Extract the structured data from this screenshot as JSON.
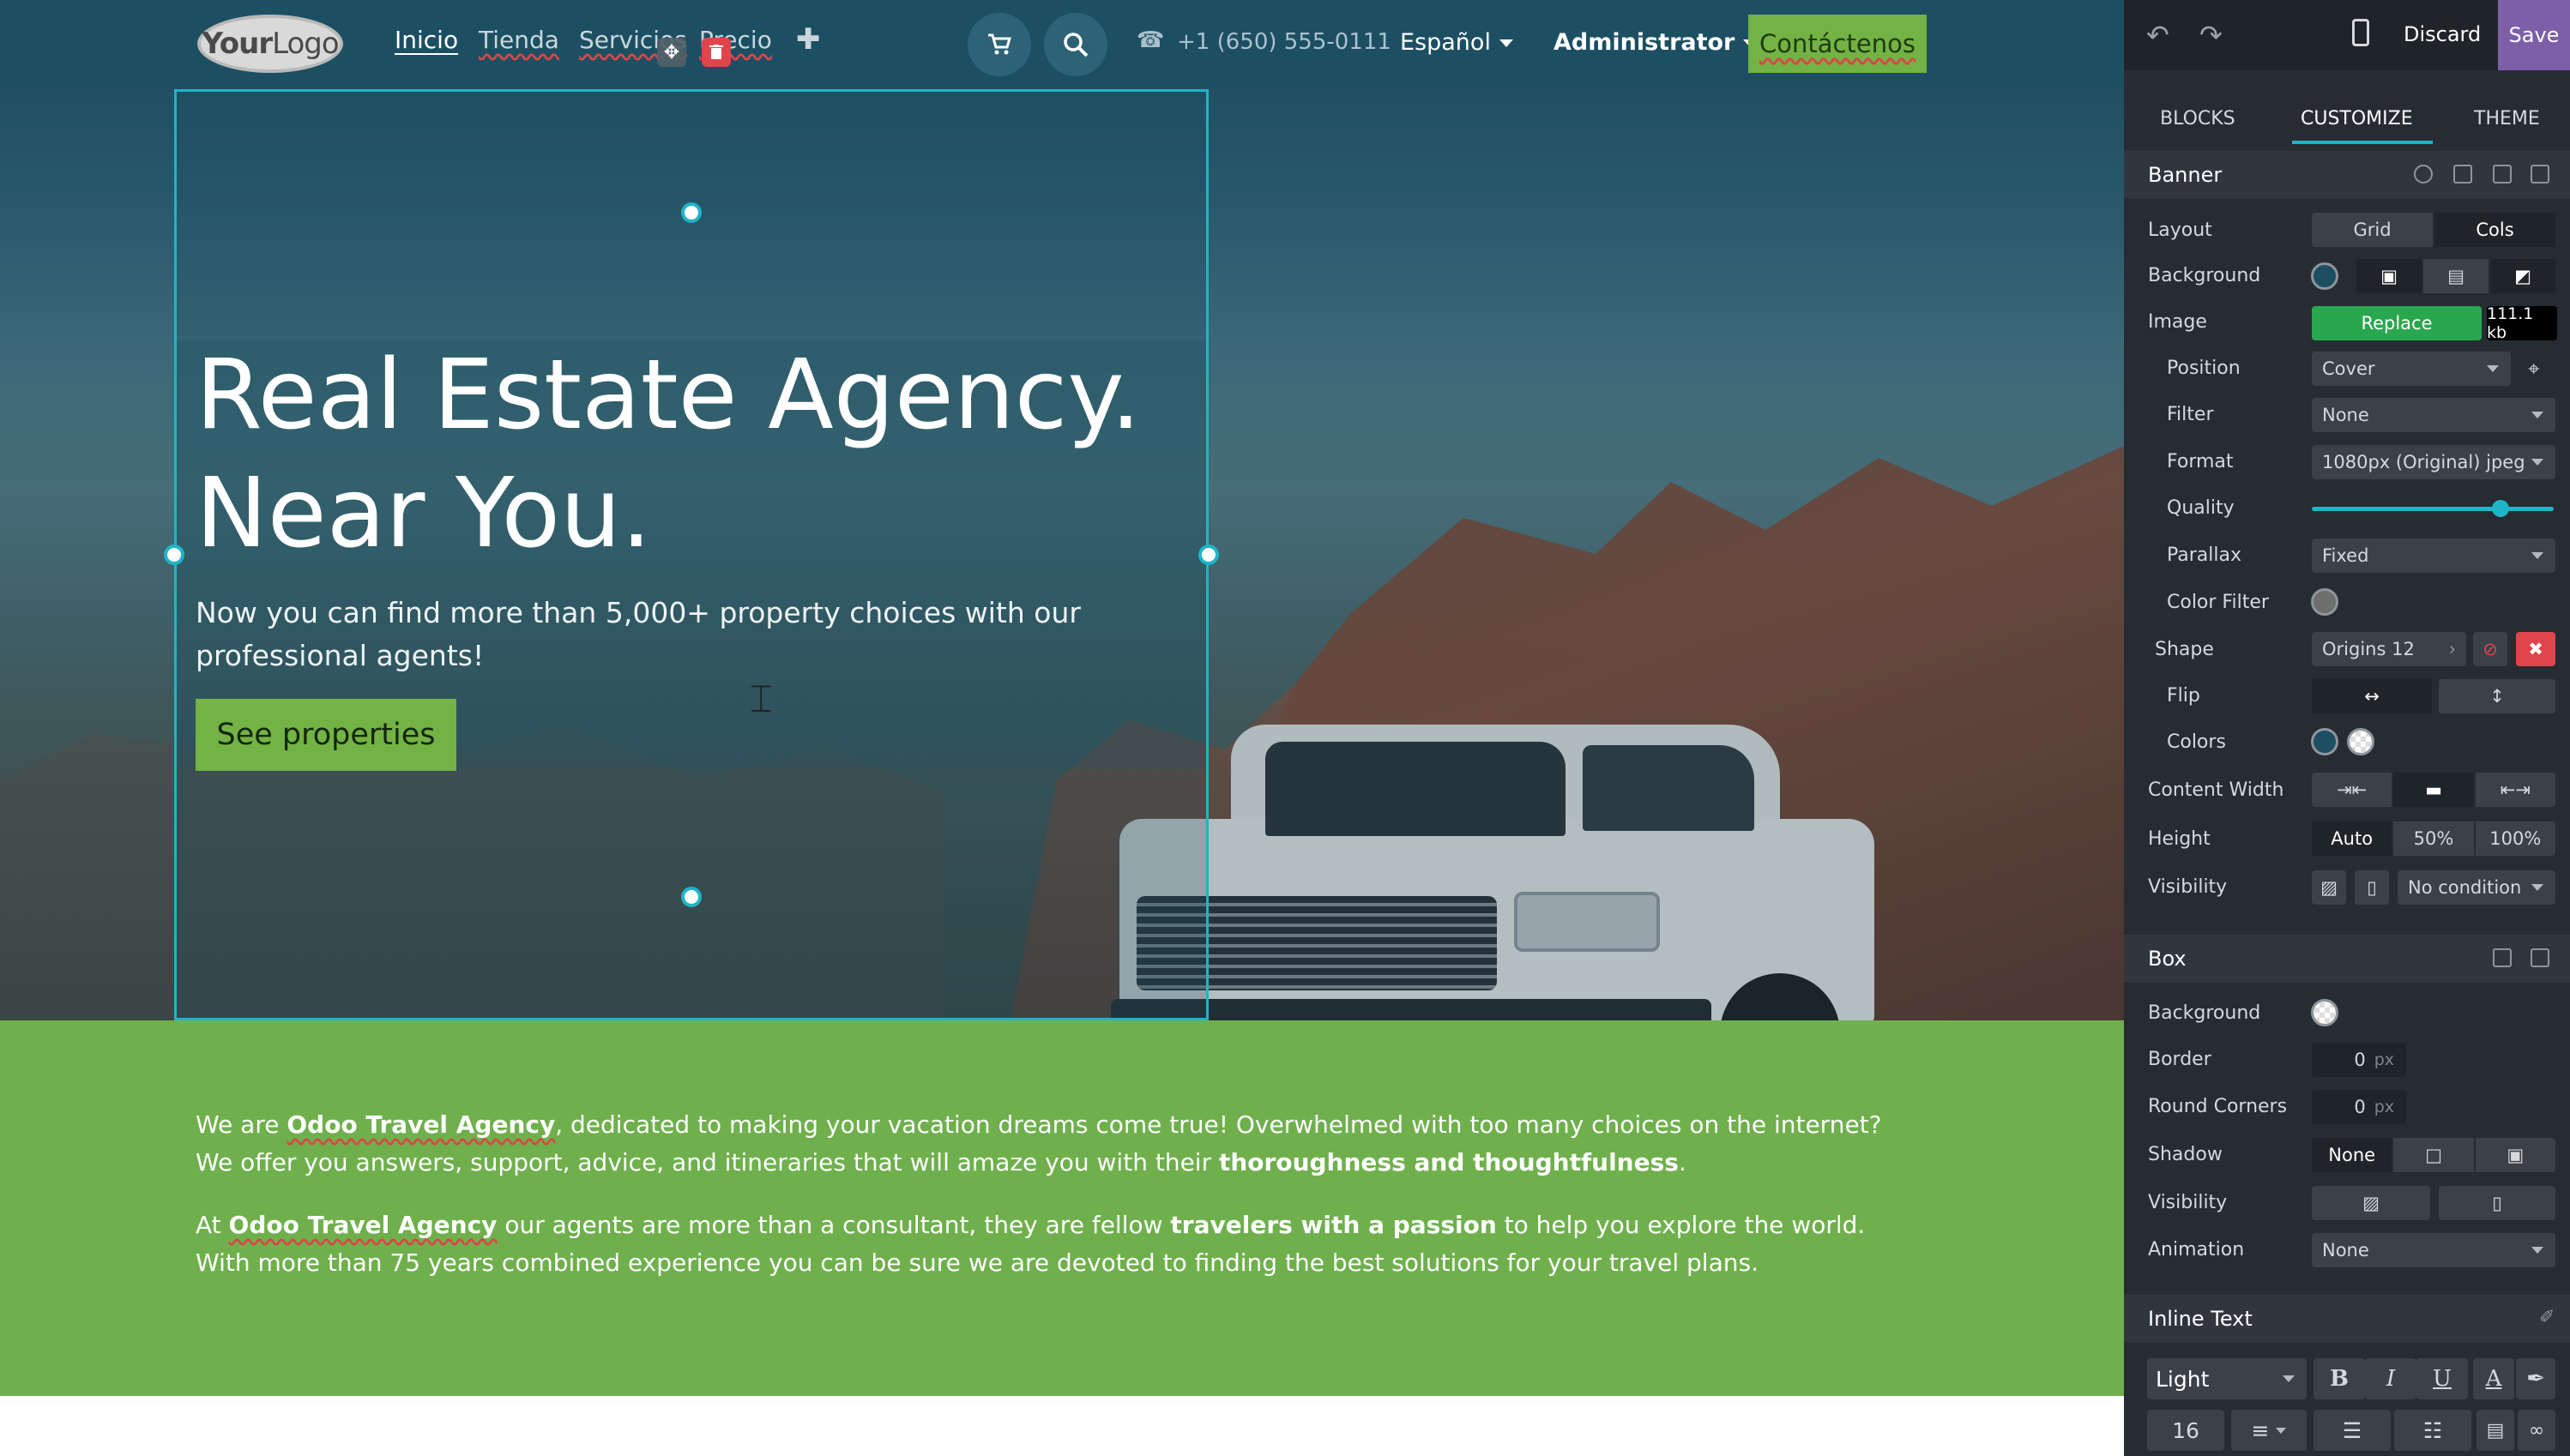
{
  "site": {
    "logo": {
      "bold": "Your",
      "light": "Logo"
    },
    "nav": [
      "Inicio",
      "Tienda",
      "Servicios",
      "Precio"
    ],
    "phone": "+1 (650) 555-0111",
    "language": "Español",
    "admin": "Administrator",
    "contact_button": "Contáctenos",
    "hero": {
      "title_line1": "Real Estate Agency.",
      "title_line2": "Near You.",
      "subtitle": "Now you can find more than 5,000+ property choices with our professional agents!",
      "cta": "See properties"
    },
    "about": {
      "p1": {
        "a": "We are ",
        "b": "Odoo Travel Agency",
        "c": ", dedicated to making your vacation dreams come true! Overwhelmed with too many choices on the internet? We offer you answers, support, advice, and itineraries that will amaze you with their ",
        "d": "thoroughness and thoughtfulness",
        "e": "."
      },
      "p2": {
        "a": "At ",
        "b": "Odoo Travel Agency",
        "c": " our agents are more than a consultant, they are fellow ",
        "d": "travelers with a passion",
        "e": " to help you explore the world. With more than 75 years combined experience you can be sure we are devoted to finding the best solutions for your travel plans."
      }
    }
  },
  "editor": {
    "discard": "Discard",
    "save": "Save",
    "tabs": [
      "BLOCKS",
      "CUSTOMIZE",
      "THEME"
    ],
    "banner": {
      "title": "Banner",
      "layout_label": "Layout",
      "layout_options": [
        "Grid",
        "Cols"
      ],
      "background_label": "Background",
      "image_label": "Image",
      "replace_label": "Replace",
      "file_size": "111.1 kb",
      "position_label": "Position",
      "position_value": "Cover",
      "filter_label": "Filter",
      "filter_value": "None",
      "format_label": "Format",
      "format_value": "1080px (Original) jpeg",
      "quality_label": "Quality",
      "quality_level": 0.78,
      "parallax_label": "Parallax",
      "parallax_value": "Fixed",
      "color_filter_label": "Color Filter",
      "shape_label": "Shape",
      "shape_value": "Origins 12",
      "flip_label": "Flip",
      "colors_label": "Colors",
      "content_width_label": "Content Width",
      "height_label": "Height",
      "height_options": [
        "Auto",
        "50%",
        "100%"
      ],
      "visibility_label": "Visibility",
      "visibility_value": "No condition"
    },
    "box": {
      "title": "Box",
      "background_label": "Background",
      "border_label": "Border",
      "border_value": "0",
      "round_label": "Round Corners",
      "round_value": "0",
      "unit": "px",
      "shadow_label": "Shadow",
      "shadow_value": "None",
      "visibility_label": "Visibility",
      "animation_label": "Animation",
      "animation_value": "None"
    },
    "inline_text": {
      "title": "Inline Text",
      "style_value": "Light",
      "bold": "B",
      "italic": "I",
      "underline": "U",
      "font_color": "A",
      "font_size": "16"
    }
  },
  "colors": {
    "header_bg": "#1d4f63",
    "green": "#73b244",
    "section_green": "#6fb04d",
    "editor_bg": "#262c31",
    "accent": "#1fb4c7",
    "save_purple": "#7c5fa8"
  }
}
